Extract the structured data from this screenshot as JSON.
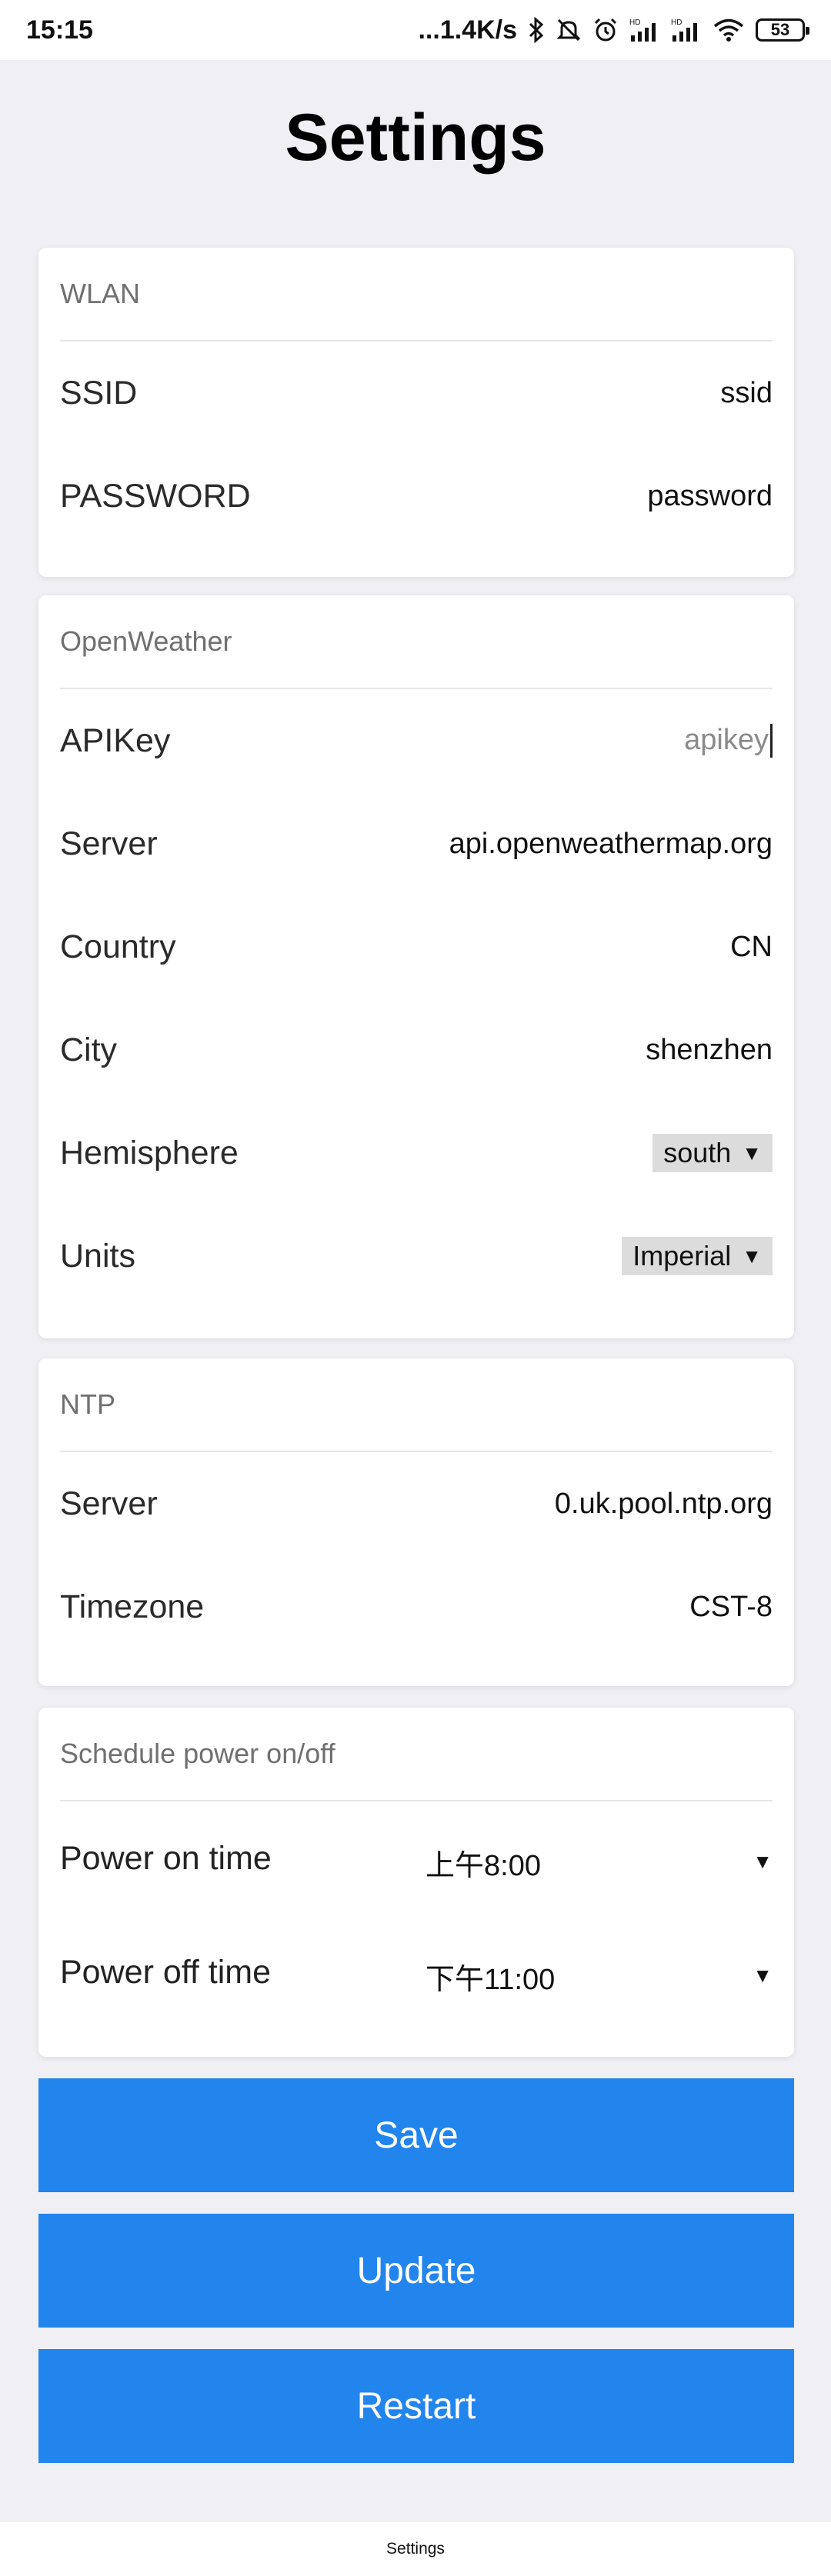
{
  "status_bar": {
    "time": "15:15",
    "network_speed": "...1.4K/s",
    "battery": "53",
    "icons": [
      "bluetooth-icon",
      "mute-icon",
      "alarm-icon",
      "signal-hd-icon",
      "signal-hd-icon",
      "wifi-icon",
      "battery-icon"
    ]
  },
  "title": "Settings",
  "wlan": {
    "header": "WLAN",
    "rows": [
      {
        "label": "SSID",
        "value": "ssid"
      },
      {
        "label": "PASSWORD",
        "value": "password"
      }
    ]
  },
  "openweather": {
    "header": "OpenWeather",
    "apikey": {
      "label": "APIKey",
      "placeholder": "apikey"
    },
    "server": {
      "label": "Server",
      "value": "api.openweathermap.org"
    },
    "country": {
      "label": "Country",
      "value": "CN"
    },
    "city": {
      "label": "City",
      "value": "shenzhen"
    },
    "hemisphere": {
      "label": "Hemisphere",
      "value": "south"
    },
    "units": {
      "label": "Units",
      "value": "Imperial"
    }
  },
  "ntp": {
    "header": "NTP",
    "server": {
      "label": "Server",
      "value": "0.uk.pool.ntp.org"
    },
    "timezone": {
      "label": "Timezone",
      "value": "CST-8"
    }
  },
  "schedule": {
    "header": "Schedule power on/off",
    "power_on": {
      "label": "Power on time",
      "value": "上午8:00"
    },
    "power_off": {
      "label": "Power off time",
      "value": "下午11:00"
    }
  },
  "buttons": {
    "save": "Save",
    "update": "Update",
    "restart": "Restart"
  },
  "footer": "Settings",
  "colors": {
    "accent": "#2285ee",
    "background": "#efeff4"
  }
}
